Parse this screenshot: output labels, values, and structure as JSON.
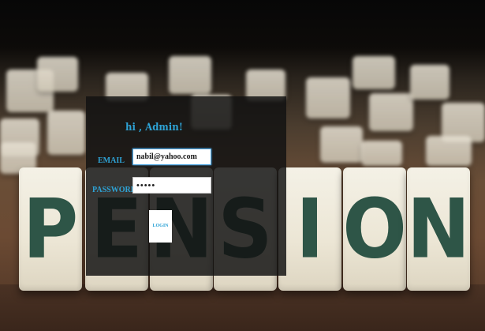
{
  "background": {
    "tile_letters": [
      "P",
      "E",
      "N",
      "S",
      "I",
      "O",
      "N"
    ],
    "letter_color": "#2e5547"
  },
  "login": {
    "greeting": "hi , Admin!",
    "email_label": "EMAIL",
    "email_value": "nabil@yahoo.com",
    "password_label": "PASSWORD",
    "password_value": "•••••",
    "login_button_label": "LOGIN",
    "accent_color": "#2ea3d6"
  }
}
